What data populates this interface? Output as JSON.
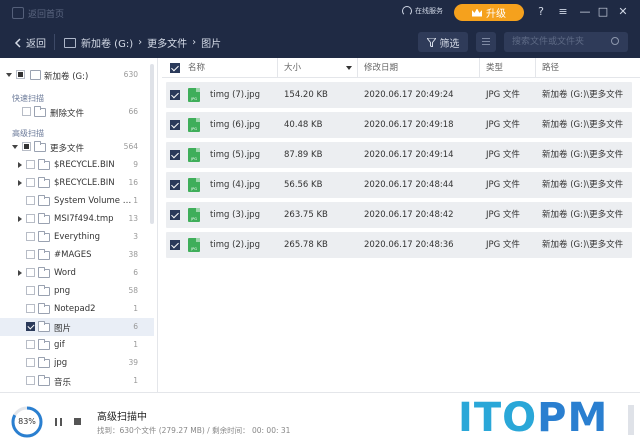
{
  "titlebar": {
    "app_title": "返回首页",
    "service": "在线服务",
    "upgrade": "升级",
    "window_controls": [
      "?",
      "≡",
      "—",
      "□",
      "✕"
    ]
  },
  "nav": {
    "back": "返回",
    "breadcrumbs": [
      "新加卷 (G:)",
      "更多文件",
      "图片"
    ],
    "filter": "筛选",
    "search_placeholder": "搜索文件或文件夹"
  },
  "sidebar": {
    "root": {
      "label": "新加卷 (G:)",
      "count": "630"
    },
    "quick_scan_title": "快速扫描",
    "quick_items": [
      {
        "label": "删除文件",
        "count": "66"
      }
    ],
    "advanced_scan_title": "高级扫描",
    "advanced_root": {
      "label": "更多文件",
      "count": "564"
    },
    "folders": [
      {
        "label": "$RECYCLE.BIN",
        "count": "9",
        "expandable": true
      },
      {
        "label": "$RECYCLE.BIN",
        "count": "16",
        "expandable": true
      },
      {
        "label": "System Volume Inf...",
        "count": "1",
        "expandable": false
      },
      {
        "label": "MSI7f494.tmp",
        "count": "13",
        "expandable": true
      },
      {
        "label": "Everything",
        "count": "3",
        "expandable": false
      },
      {
        "label": "#MAGES",
        "count": "38",
        "expandable": false
      },
      {
        "label": "Word",
        "count": "6",
        "expandable": true
      },
      {
        "label": "png",
        "count": "58",
        "expandable": false
      },
      {
        "label": "Notepad2",
        "count": "1",
        "expandable": false
      },
      {
        "label": "图片",
        "count": "6",
        "expandable": false,
        "selected": true
      },
      {
        "label": "gif",
        "count": "1",
        "expandable": false
      },
      {
        "label": "jpg",
        "count": "39",
        "expandable": false
      },
      {
        "label": "音乐",
        "count": "1",
        "expandable": false
      }
    ]
  },
  "table": {
    "columns": [
      "名称",
      "大小",
      "修改日期",
      "类型",
      "路径"
    ],
    "rows": [
      {
        "name": "timg (7).jpg",
        "size": "154.20 KB",
        "date": "2020.06.17 20:49:24",
        "type": "JPG 文件",
        "path": "新加卷 (G:)\\更多文件"
      },
      {
        "name": "timg (6).jpg",
        "size": "40.48 KB",
        "date": "2020.06.17 20:49:18",
        "type": "JPG 文件",
        "path": "新加卷 (G:)\\更多文件"
      },
      {
        "name": "timg (5).jpg",
        "size": "87.89 KB",
        "date": "2020.06.17 20:49:14",
        "type": "JPG 文件",
        "path": "新加卷 (G:)\\更多文件"
      },
      {
        "name": "timg (4).jpg",
        "size": "56.56 KB",
        "date": "2020.06.17 20:48:44",
        "type": "JPG 文件",
        "path": "新加卷 (G:)\\更多文件"
      },
      {
        "name": "timg (3).jpg",
        "size": "263.75 KB",
        "date": "2020.06.17 20:48:42",
        "type": "JPG 文件",
        "path": "新加卷 (G:)\\更多文件"
      },
      {
        "name": "timg (2).jpg",
        "size": "265.78 KB",
        "date": "2020.06.17 20:48:36",
        "type": "JPG 文件",
        "path": "新加卷 (G:)\\更多文件"
      }
    ]
  },
  "status": {
    "progress_label": "83%",
    "progress_value": 0.83,
    "title": "高级扫描中",
    "detail": "找到：630个文件 (279.27 MB) / 剩余时间：  00: 00: 31"
  },
  "watermark": {
    "part1": "ITO",
    "part2": "PM"
  },
  "colors": {
    "header_bg": "#1f2a44",
    "accent": "#f5a11d",
    "progress": "#2a7fd0",
    "checkbox": "#2b3a5a"
  }
}
